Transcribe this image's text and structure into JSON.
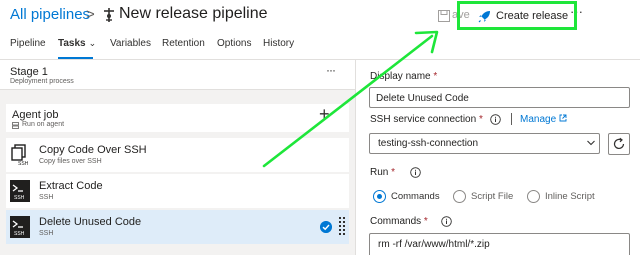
{
  "breadcrumb": {
    "root": "All pipelines",
    "separator": ">"
  },
  "pipeline": {
    "title": "New release pipeline"
  },
  "toolbar": {
    "save_label": "ave",
    "create_release_label": "Create release",
    "more_label": "···"
  },
  "tabs": [
    {
      "label": "Pipeline"
    },
    {
      "label": "Tasks",
      "chevron": "⌄"
    },
    {
      "label": "Variables"
    },
    {
      "label": "Retention"
    },
    {
      "label": "Options"
    },
    {
      "label": "History"
    }
  ],
  "stage": {
    "title": "Stage 1",
    "subtitle": "Deployment process",
    "more": "···"
  },
  "agent_job": {
    "title": "Agent job",
    "subtitle": "Run on agent",
    "add": "+"
  },
  "tasks": [
    {
      "title": "Copy Code Over SSH",
      "subtitle": "Copy files over SSH",
      "icon": "copy-files-over-ssh-icon"
    },
    {
      "title": "Extract Code",
      "subtitle": "SSH",
      "icon": "ssh-terminal-icon"
    },
    {
      "title": "Delete Unused Code",
      "subtitle": "SSH",
      "icon": "ssh-terminal-icon",
      "selected": true
    }
  ],
  "details": {
    "display_name_label": "Display name",
    "display_name_value": "Delete Unused Code",
    "ssh_connection_label": "SSH service connection",
    "manage_label": "Manage",
    "ssh_connection_value": "testing-ssh-connection",
    "run_label": "Run",
    "run_options": [
      {
        "label": "Commands",
        "selected": true
      },
      {
        "label": "Script File",
        "selected": false
      },
      {
        "label": "Inline Script",
        "selected": false
      }
    ],
    "commands_label": "Commands",
    "commands_value": "rm -rf  /var/www/html/*.zip"
  },
  "required_marker": "*",
  "colors": {
    "accent": "#0078d4",
    "highlight_box": "#1ee63a",
    "annotation_arrow": "#1ee63a",
    "selected_row": "#deecf9",
    "required": "#a4262c"
  }
}
